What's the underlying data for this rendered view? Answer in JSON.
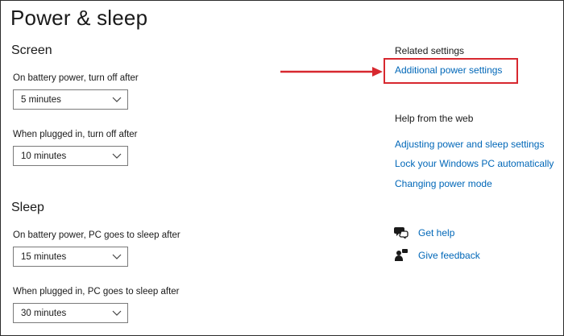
{
  "page_title": "Power & sleep",
  "screen": {
    "title": "Screen",
    "battery_label": "On battery power, turn off after",
    "battery_value": "5 minutes",
    "plugged_label": "When plugged in, turn off after",
    "plugged_value": "10 minutes"
  },
  "sleep": {
    "title": "Sleep",
    "battery_label": "On battery power, PC goes to sleep after",
    "battery_value": "15 minutes",
    "plugged_label": "When plugged in, PC goes to sleep after",
    "plugged_value": "30 minutes"
  },
  "related": {
    "heading": "Related settings",
    "link": "Additional power settings"
  },
  "help_web": {
    "heading": "Help from the web",
    "links": [
      "Adjusting power and sleep settings",
      "Lock your Windows PC automatically",
      "Changing power mode"
    ]
  },
  "support": {
    "get_help": "Get help",
    "give_feedback": "Give feedback"
  },
  "colors": {
    "link": "#0067b8",
    "highlight": "#d7282f",
    "text": "#1a1a1a"
  },
  "icons": {
    "dropdown": "chevron-down-icon",
    "get_help": "chat-help-icon",
    "feedback": "person-feedback-icon"
  }
}
